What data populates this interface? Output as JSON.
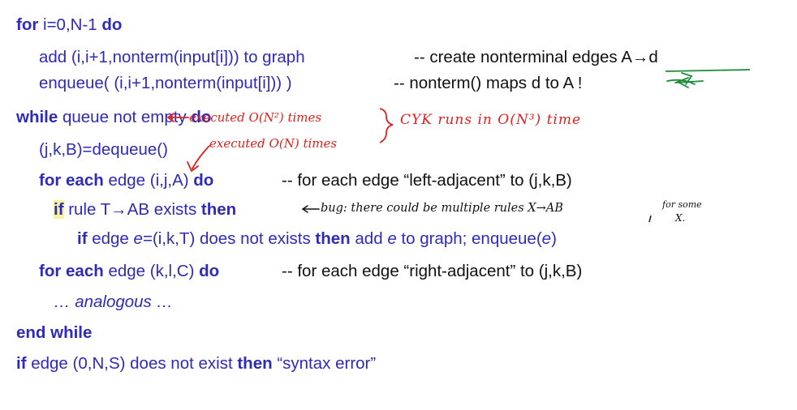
{
  "code": {
    "l1_for": "for",
    "l1_mid": " i=0,N-1 ",
    "l1_do": "do",
    "l2_text": "add (i,i+1,nonterm(input[i])) to graph",
    "l2_comment": "-- create nonterminal edges A→d",
    "l3_text": "enqueue( (i,i+1,nonterm(input[i])) )",
    "l3_comment": "-- nonterm() maps d to A !",
    "l4_while": "while",
    "l4_mid": " queue not empty ",
    "l4_do": "do",
    "l5_text": "(j,k,B)=dequeue()",
    "l6_foreach": "for each",
    "l6_mid": " edge (i,j,A) ",
    "l6_do": "do",
    "l6_comment": "-- for each edge “left-adjacent” to (j,k,B)",
    "l7_if": "if",
    "l7_mid": " rule T→AB  exists ",
    "l7_then": "then",
    "l8_if": "if",
    "l8_mid1": " edge ",
    "l8_e1": "e",
    "l8_mid2": "=(i,k,T) does not exists ",
    "l8_then": "then",
    "l8_mid3": "  add ",
    "l8_e2": "e",
    "l8_mid4": " to graph; enqueue(",
    "l8_e3": "e",
    "l8_end": ")",
    "l9_foreach": "for each",
    "l9_mid": " edge (k,l,C) ",
    "l9_do": "do",
    "l9_comment": "-- for each edge “right-adjacent” to (j,k,B)",
    "l10_text": "… analogous …",
    "l11_text": "end while",
    "l12_if": "if",
    "l12_mid": " edge (0,N,S) does not exist  ",
    "l12_then": "then",
    "l12_end": " “syntax error”"
  },
  "annotations": {
    "while_note": "executed O(N²) times",
    "for_note": "executed O(N) times",
    "cyk_note": "CYK runs in O(N³) time",
    "bug_note": "bug: there could be multiple rules X→AB",
    "for_some": "for some",
    "x_dot": "X."
  },
  "colors": {
    "code_blue": "#2e2bb8",
    "comment_black": "#111111",
    "ink_red": "#e02020",
    "ink_green": "#1e8a3c",
    "highlight_yellow": "#f6f3a0"
  }
}
